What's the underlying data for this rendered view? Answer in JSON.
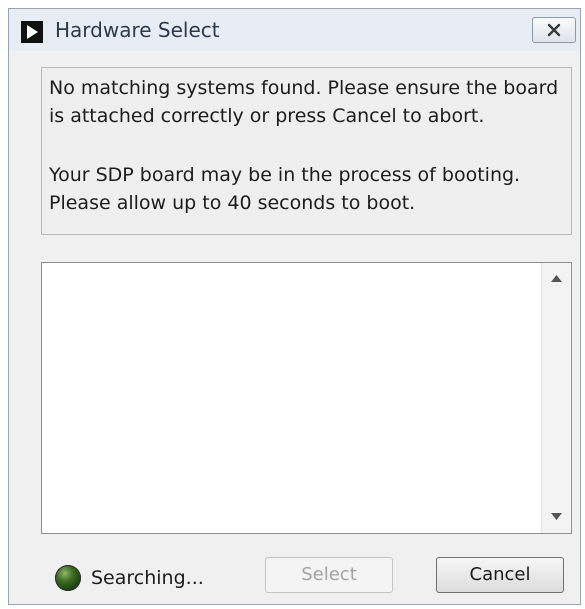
{
  "window": {
    "title": "Hardware Select",
    "close_icon": "close-x"
  },
  "message": {
    "line1": "No matching systems found. Please ensure the board",
    "line2": "is attached correctly or press Cancel to abort.",
    "line3": "Your SDP board may be in the process of booting.",
    "line4": "Please allow up to 40 seconds to boot."
  },
  "device_list": {
    "items": [],
    "scroll_up_icon": "triangle-up",
    "scroll_down_icon": "triangle-down"
  },
  "status": {
    "indicator_icon": "status-led",
    "indicator_color": "#2f5a1a",
    "text": "Searching..."
  },
  "buttons": {
    "select_label": "Select",
    "select_enabled": false,
    "cancel_label": "Cancel"
  }
}
